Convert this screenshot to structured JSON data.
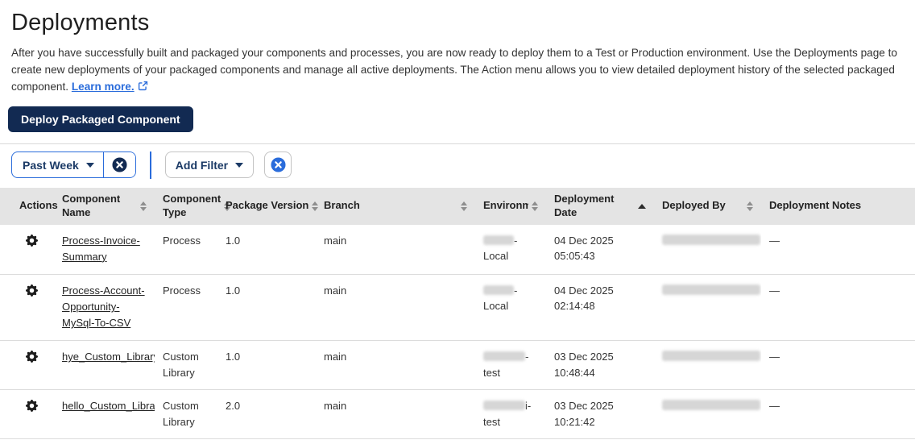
{
  "page": {
    "title": "Deployments",
    "description": "After you have successfully built and packaged your components and processes, you are now ready to deploy them to a Test or Production environment. Use the Deployments page to create new deployments of your packaged components and manage all active deployments. The Action menu allows you to view detailed deployment history of the selected packaged component.",
    "learn_more": "Learn more.",
    "deploy_button": "Deploy Packaged Component"
  },
  "filter_bar": {
    "date_filter_label": "Past Week",
    "add_filter_label": "Add Filter"
  },
  "colors": {
    "accent_blue": "#2a6cdb",
    "navy_button": "#122a52",
    "header_background": "#e4e4e4"
  },
  "table": {
    "columns": [
      "Actions",
      "Component Name",
      "Component Type",
      "Package Version",
      "Branch",
      "Environment",
      "Deployment Date",
      "Deployed By",
      "Deployment Notes"
    ],
    "sort": {
      "column": "Deployment Date",
      "icon": "up-triangle"
    },
    "rows": [
      {
        "component_name": "Process-Invoice-Summary",
        "component_type": "Process",
        "package_version": "1.0",
        "branch": "main",
        "environment_redacted": true,
        "environment_suffix": "-Local",
        "deployment_date": "04 Dec 2025 05:05:43",
        "deployed_by_redacted": true,
        "deployment_notes": "—"
      },
      {
        "component_name": "Process-Account-Opportunity-MySql-To-CSV",
        "component_type": "Process",
        "package_version": "1.0",
        "branch": "main",
        "environment_redacted": true,
        "environment_suffix": "-Local",
        "deployment_date": "04 Dec 2025 02:14:48",
        "deployed_by_redacted": true,
        "deployment_notes": "—"
      },
      {
        "component_name": "hye_Custom_Library",
        "component_type": "Custom Library",
        "package_version": "1.0",
        "branch": "main",
        "environment_redacted": true,
        "environment_suffix": "-",
        "environment_line2": "test",
        "deployment_date": "03 Dec 2025 10:48:44",
        "deployed_by_redacted": true,
        "deployment_notes": "—"
      },
      {
        "component_name": "hello_Custom_Library",
        "component_type": "Custom Library",
        "package_version": "2.0",
        "branch": "main",
        "environment_redacted": true,
        "environment_suffix": "i-",
        "environment_line2": "test",
        "deployment_date": "03 Dec 2025 10:21:42",
        "deployed_by_redacted": true,
        "deployment_notes": "—"
      }
    ]
  }
}
